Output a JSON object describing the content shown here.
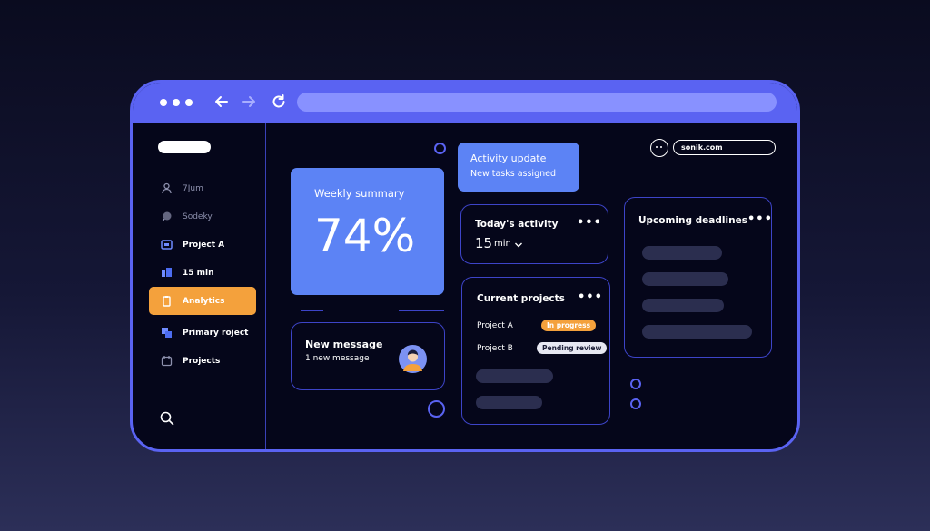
{
  "sidebar": {
    "items": [
      {
        "label": "7Jum",
        "icon": "user-icon",
        "state": "dim"
      },
      {
        "label": "Sodeky",
        "icon": "chat-icon",
        "state": "dim"
      },
      {
        "label": "Project   A",
        "icon": "folder-icon",
        "state": "normal"
      },
      {
        "label": "15 min",
        "icon": "clock-icon",
        "state": "normal"
      },
      {
        "label": "Analytics",
        "icon": "clipboard-icon",
        "state": "active"
      },
      {
        "label": "Primary roject",
        "icon": "stack-icon",
        "state": "normal"
      },
      {
        "label": "Projects",
        "icon": "calendar-icon",
        "state": "normal"
      }
    ]
  },
  "header": {
    "account": "sonik.com"
  },
  "weekly": {
    "title": "Weekly summary",
    "value": "74%"
  },
  "activity_update": {
    "title": "Activity update",
    "subtitle": "New tasks assigned"
  },
  "today": {
    "title": "Today's activity",
    "value": "15",
    "unit": "min"
  },
  "message": {
    "title": "New message",
    "subtitle": "1 new message"
  },
  "projects": {
    "title": "Current projects",
    "rows": [
      {
        "name": "Project A",
        "status": "In progress"
      },
      {
        "name": "Project B",
        "status": "Pending review"
      }
    ]
  },
  "deadlines": {
    "title": "Upcoming deadlines"
  },
  "colors": {
    "accent": "#5a63f2",
    "active": "#f4a13c",
    "card_blue": "#5c83f5"
  }
}
